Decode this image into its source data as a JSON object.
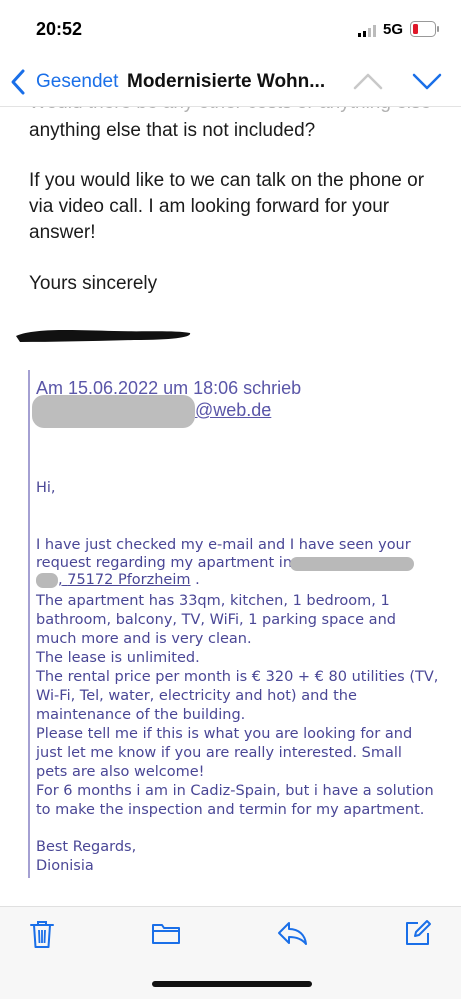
{
  "status_bar": {
    "time": "20:52",
    "network": "5G"
  },
  "nav": {
    "back_label": "Gesendet",
    "subject": "Modernisierte Wohn..."
  },
  "reply": {
    "faded_line": "Would there be any other costs or anything else",
    "paragraphs": [
      "anything else that is not included?",
      "If you would like to we can talk on the phone or via video call. I am looking forward for your answer!",
      "Yours sincerely"
    ]
  },
  "quote": {
    "header_line": "Am 15.06.2022 um 18:06 schrieb",
    "email_domain": "@web.de",
    "colon": ":",
    "lines": [
      "Hi,",
      "I have just checked my e-mail and I have seen your",
      "request regarding my apartment in",
      "The apartment has 33qm, kitchen, 1 bedroom, 1",
      "bathroom, balcony, TV, WiFi, 1 parking space and",
      "much more and is very clean.",
      "The lease is unlimited.",
      "The rental price per month is € 320 + € 80 utilities (TV,",
      "Wi-Fi, Tel, water, electricity and hot) and the",
      "maintenance of the building.",
      "Please tell me if this is what you are looking for and",
      "just let me know if you are really interested. Small",
      "pets are also welcome!",
      "For 6 months i am in Cadiz-Spain, but i have a solution",
      "to make the inspection and termin for my apartment.",
      "Best Regards,",
      "Dionisia"
    ],
    "city": "75172 Pforzheim",
    "city_prefix": ",",
    "city_suffix": " ."
  },
  "toolbar": {
    "icons": [
      "trash-icon",
      "folder-icon",
      "reply-icon",
      "compose-icon"
    ]
  },
  "colors": {
    "accent": "#1a6fe8",
    "quote_text": "#4a4796"
  }
}
